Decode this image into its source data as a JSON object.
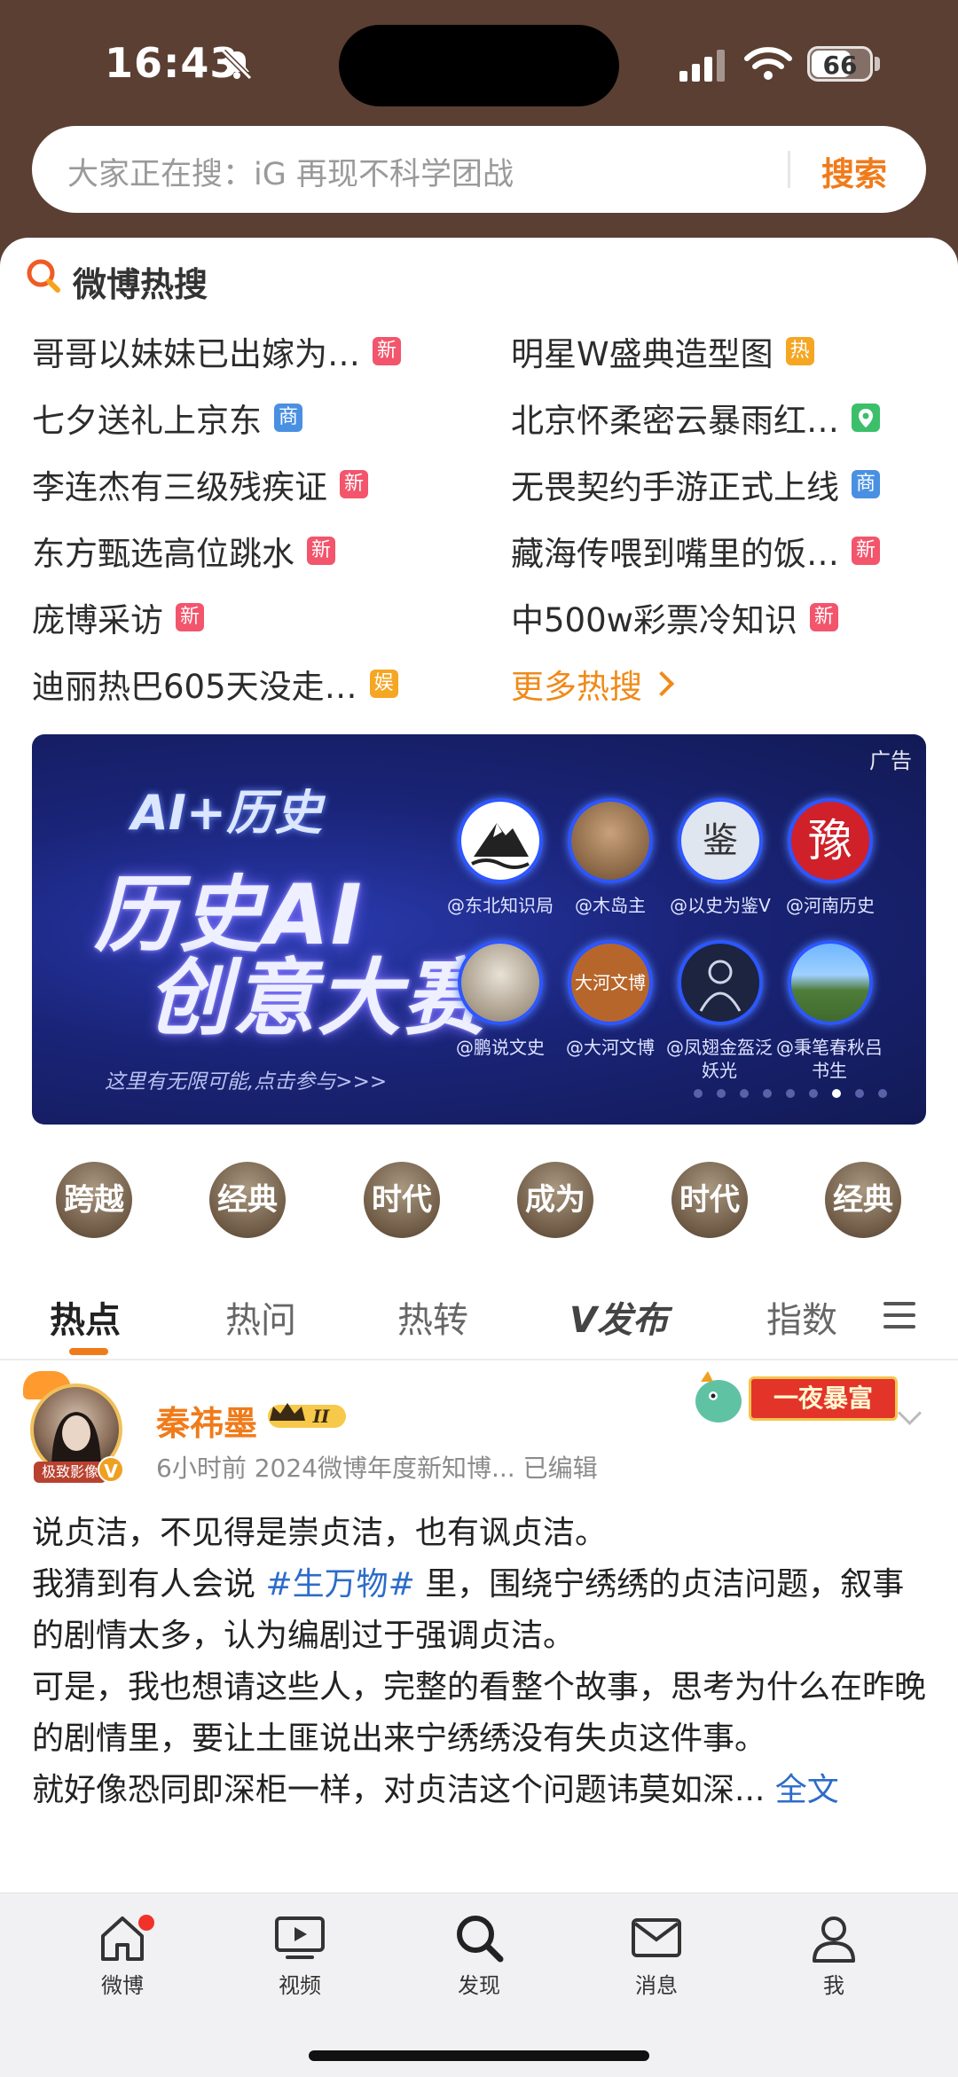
{
  "status_bar": {
    "time": "16:43",
    "battery": "66",
    "battery_level": 0.66
  },
  "search": {
    "placeholder": "大家正在搜：iG 再现不科学团战",
    "button": "搜索"
  },
  "hot_search": {
    "title": "微博热搜",
    "items": [
      {
        "text": "哥哥以妹妹已出嫁为…",
        "tag": "新",
        "tag_color": "#f2556c"
      },
      {
        "text": "明星W盛典造型图",
        "tag": "热",
        "tag_color": "#f5a623"
      },
      {
        "text": "七夕送礼上京东",
        "tag": "商",
        "tag_color": "#4a90e2"
      },
      {
        "text": "北京怀柔密云暴雨红…",
        "tag": "location",
        "tag_color": "#3cbf6a"
      },
      {
        "text": "李连杰有三级残疾证",
        "tag": "新",
        "tag_color": "#f2556c"
      },
      {
        "text": "无畏契约手游正式上线",
        "tag": "商",
        "tag_color": "#4a90e2"
      },
      {
        "text": "东方甄选高位跳水",
        "tag": "新",
        "tag_color": "#f2556c"
      },
      {
        "text": "藏海传喂到嘴里的饭…",
        "tag": "新",
        "tag_color": "#f2556c"
      },
      {
        "text": "庞博采访",
        "tag": "新",
        "tag_color": "#f2556c"
      },
      {
        "text": "中500w彩票冷知识",
        "tag": "新",
        "tag_color": "#f2556c"
      },
      {
        "text": "迪丽热巴605天没走…",
        "tag": "娱",
        "tag_color": "#f5a623"
      }
    ],
    "more": "更多热搜"
  },
  "ad": {
    "tag": "广告",
    "ai_title": "AI+历史",
    "line1": "历史AI",
    "line2": "创意大赛",
    "sub": "这里有无限可能,点击参与>>>",
    "accounts": [
      "@东北知识局",
      "@木岛主",
      "@以史为鉴V",
      "@河南历史",
      "@鹏说文史",
      "@大河文博",
      "@凤翅金盔泛妖光",
      "@秉笔春秋吕书生"
    ],
    "avatar_text": {
      "henan": "豫",
      "jian": "鉴",
      "dahe": "大河文博"
    },
    "dot_count": 9,
    "active_dot": 6
  },
  "pills": [
    "跨越",
    "经典",
    "时代",
    "成为",
    "时代",
    "经典"
  ],
  "tabs": [
    "热点",
    "热问",
    "热转",
    "发布",
    "指数"
  ],
  "post": {
    "author": "秦祎墨",
    "level": "II",
    "avatar_banner": "极致影像",
    "meta": "6小时前  2024微博年度新知博...  已编辑",
    "promo": "一夜暴富",
    "p1": "说贞洁，不见得是崇贞洁，也有讽贞洁。",
    "p2_before": "我猜到有人会说 ",
    "hashtag": "#生万物#",
    "p2_after": " 里，围绕宁绣绣的贞洁问题，叙事的剧情太多，认为编剧过于强调贞洁。",
    "p3": "可是，我也想请这些人，完整的看整个故事，思考为什么在昨晚的剧情里，要让土匪说出来宁绣绣没有失贞这件事。",
    "p4": "就好像恐同即深柜一样，对贞洁这个问题讳莫如深...",
    "full_text": "全文"
  },
  "bottom_nav": [
    "微博",
    "视频",
    "发现",
    "消息",
    "我"
  ]
}
